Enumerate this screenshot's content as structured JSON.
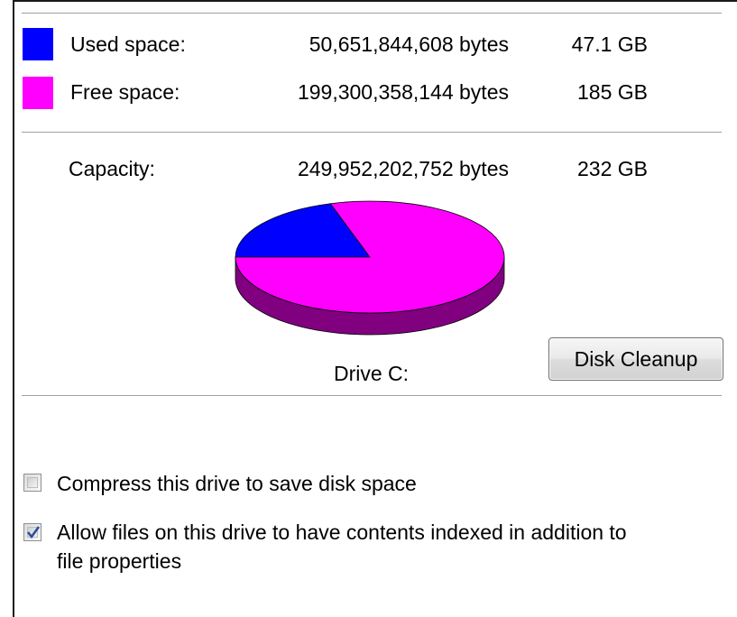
{
  "legend": {
    "used": {
      "label": "Used space:",
      "bytes": "50,651,844,608 bytes",
      "size": "47.1 GB",
      "color": "#0000ff"
    },
    "free": {
      "label": "Free space:",
      "bytes": "199,300,358,144 bytes",
      "size": "185 GB",
      "color": "#ff00ff"
    },
    "capacity": {
      "label": "Capacity:",
      "bytes": "249,952,202,752 bytes",
      "size": "232 GB"
    }
  },
  "drive_label": "Drive C:",
  "disk_cleanup_label": "Disk Cleanup",
  "options": {
    "compress": {
      "label": "Compress this drive to save disk space",
      "checked": false
    },
    "index": {
      "label_line1": "Allow files on this drive to have contents indexed in addition to",
      "label_line2": "file properties",
      "checked": true
    }
  },
  "chart_data": {
    "type": "pie",
    "slices": [
      {
        "name": "Used space",
        "value": 50651844608,
        "color": "#0000ff",
        "shadow": "#000080"
      },
      {
        "name": "Free space",
        "value": 199300358144,
        "color": "#ff00ff",
        "shadow": "#800080"
      }
    ],
    "label": "Drive C:"
  }
}
